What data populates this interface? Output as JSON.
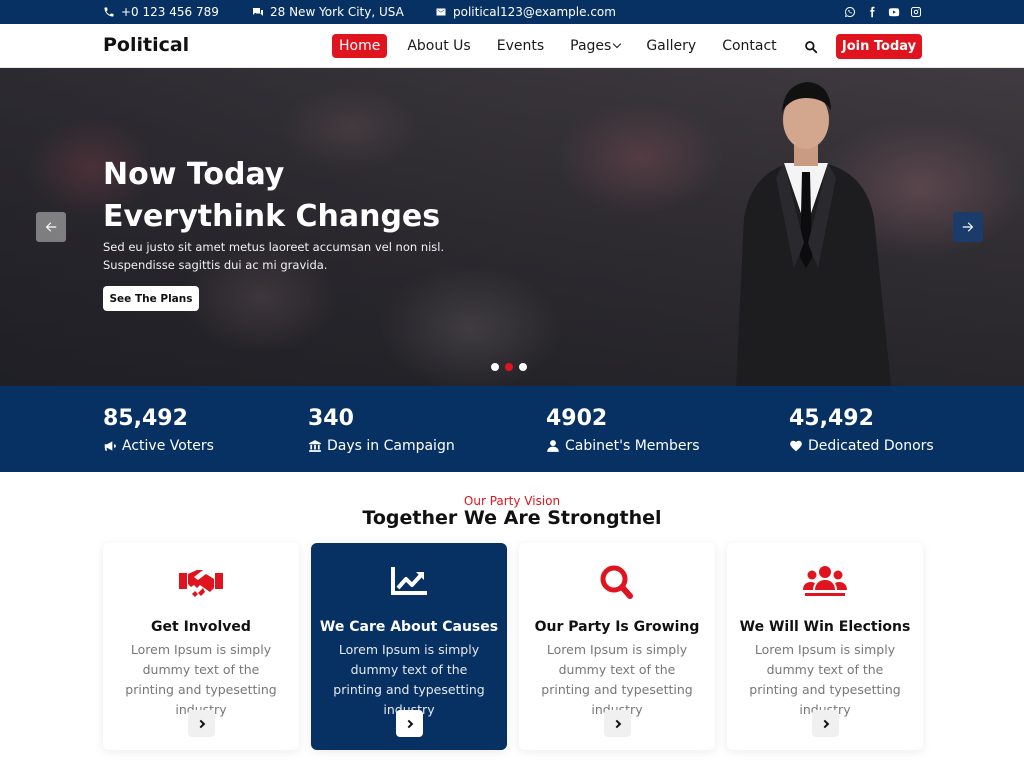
{
  "topbar": {
    "phone": "+0 123 456 789",
    "address": "28 New York City, USA",
    "email": "political123@example.com",
    "socials": [
      "whatsapp-icon",
      "facebook-icon",
      "youtube-icon",
      "instagram-icon"
    ]
  },
  "nav": {
    "logo": "Political",
    "items": [
      {
        "label": "Home",
        "active": true
      },
      {
        "label": "About Us"
      },
      {
        "label": "Events"
      },
      {
        "label": "Pages",
        "has_dropdown": true
      },
      {
        "label": "Gallery"
      },
      {
        "label": "Contact"
      }
    ],
    "join_label": "Join Today"
  },
  "hero": {
    "title_line1": "Now Today",
    "title_line2": "Everythink Changes",
    "text": "Sed eu justo sit amet metus laoreet accumsan vel non nisl. Suspendisse sagittis dui ac mi gravida.",
    "cta_label": "See The Plans",
    "slides": 3,
    "active_slide": 2
  },
  "stats": [
    {
      "value": "85,492",
      "label": "Active Voters",
      "icon": "megaphone-icon"
    },
    {
      "value": "340",
      "label": "Days in Campaign",
      "icon": "building-icon"
    },
    {
      "value": "4902",
      "label": "Cabinet's Members",
      "icon": "user-icon"
    },
    {
      "value": "45,492",
      "label": "Dedicated Donors",
      "icon": "heart-icon"
    }
  ],
  "vision": {
    "kicker": "Our Party Vision",
    "heading": "Together We Are Strongthel",
    "cards": [
      {
        "title": "Get Involved",
        "text": "Lorem Ipsum is simply dummy text of the printing and typesetting industry",
        "icon": "handshake-icon"
      },
      {
        "title": "We Care About Causes",
        "text": "Lorem Ipsum is simply dummy text of the printing and typesetting industry",
        "icon": "chart-line-icon",
        "highlighted": true
      },
      {
        "title": "Our Party Is Growing",
        "text": "Lorem Ipsum is simply dummy text of the printing and typesetting industry",
        "icon": "search-icon"
      },
      {
        "title": "We Will Win Elections",
        "text": "Lorem Ipsum is simply dummy text of the printing and typesetting industry",
        "icon": "users-icon"
      }
    ]
  },
  "colors": {
    "primary": "#083163",
    "accent": "#e0141e"
  }
}
